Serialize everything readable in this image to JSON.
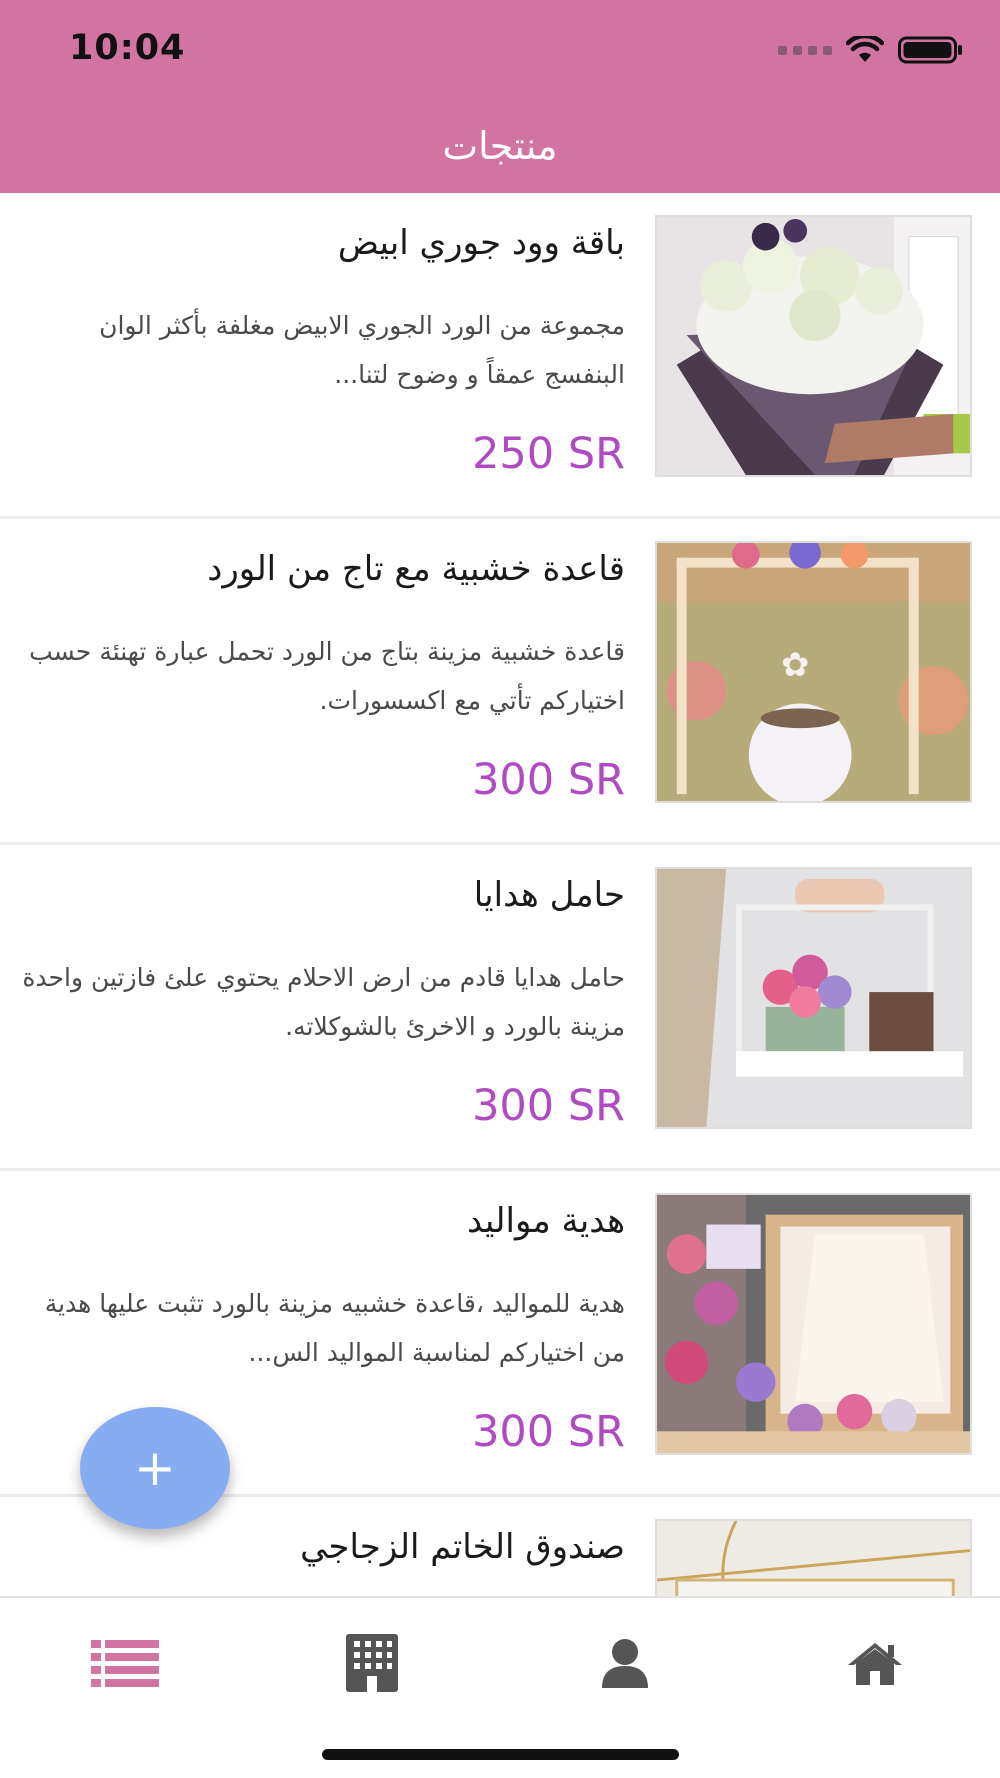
{
  "status_bar": {
    "time": "10:04"
  },
  "header": {
    "title": "منتجات"
  },
  "products": [
    {
      "title": "باقة وود جوري ابيض",
      "description": "مجموعة من الورد الجوري الابيض مغلفة بأكثر الوان البنفسج عمقاً و وضوح لتنا...",
      "price": "250 SR",
      "image": "white-rose-bouquet"
    },
    {
      "title": "قاعدة خشبية مع تاج من الورد",
      "description": "قاعدة خشبية مزينة بتاج من الورد تحمل عبارة تهنئة حسب اختياركم تأتي مع اكسسورات.",
      "price": "300 SR",
      "image": "wooden-stand-flower-crown"
    },
    {
      "title": "حامل هدايا",
      "description": "حامل هدايا قادم من ارض الاحلام يحتوي علئ فازتين واحدة مزينة بالورد و الاخرئ بالشوكلاته.",
      "price": "300 SR",
      "image": "gift-holder"
    },
    {
      "title": "هدية مواليد",
      "description": "هدية للمواليد ،قاعدة خشبيه مزينة بالورد تثبت عليها هدية من اختياركم لمناسبة المواليد الس...",
      "price": "300 SR",
      "image": "newborn-gift"
    },
    {
      "title": "صندوق الخاتم الزجاجي",
      "description": "",
      "price": "",
      "image": "glass-ring-box"
    }
  ],
  "fab": {
    "label": "+"
  },
  "tabbar": {
    "tabs": [
      {
        "icon": "list-icon",
        "active": true
      },
      {
        "icon": "building-icon",
        "active": false
      },
      {
        "icon": "user-icon",
        "active": false
      },
      {
        "icon": "home-icon",
        "active": false
      }
    ]
  },
  "colors": {
    "header": "#d174a2",
    "price": "#b04ac2",
    "fab": "#86acf1",
    "active_tab": "#d174a2",
    "inactive_tab": "#555555"
  }
}
